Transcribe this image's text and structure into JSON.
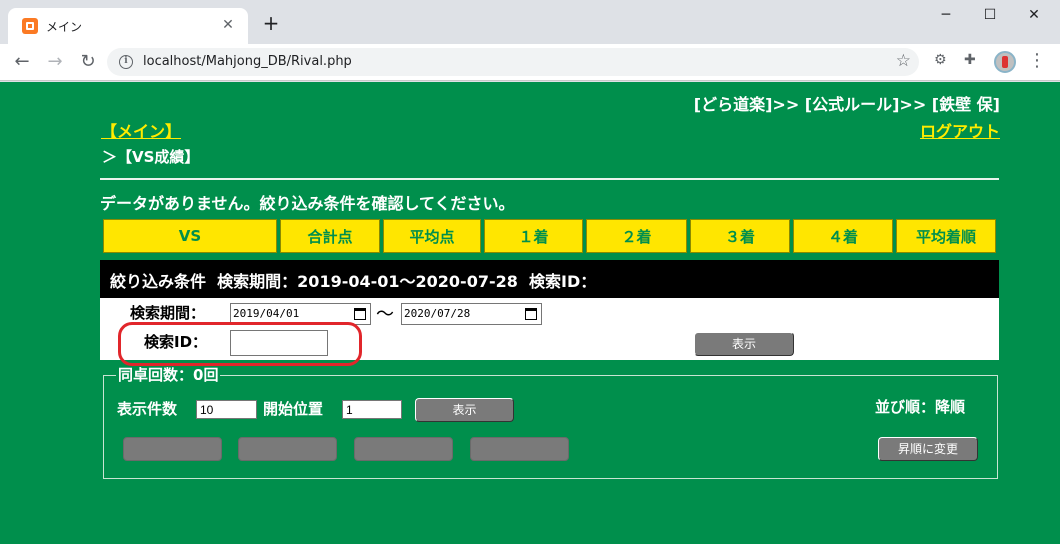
{
  "browser": {
    "tab_title": "メイン",
    "tab_close": "✕",
    "new_tab": "+",
    "url": "localhost/Mahjong_DB/Rival.php",
    "window": {
      "minimize": "─",
      "maximize": "☐",
      "close": "✕"
    }
  },
  "header": {
    "breadcrumb": "[どら道楽]>> [公式ルール]>> [鉄壁 保]",
    "main_link": "【メイン】",
    "logout_link": "ログアウト",
    "current_page": "＞【VS成績】"
  },
  "message": "データがありません。絞り込み条件を確認してください。",
  "table": {
    "columns": [
      "VS",
      "合計点",
      "平均点",
      "１着",
      "２着",
      "３着",
      "４着",
      "平均着順"
    ]
  },
  "filter": {
    "summary_title": "絞り込み条件",
    "summary_period_label": "検索期間：",
    "summary_period_value": "2019-04-01～2020-07-28",
    "summary_id_label": "検索ID：",
    "period_label": "検索期間：",
    "date_from": "2019/04/01",
    "date_to": "2020/07/28",
    "tilde": "〜",
    "id_label": "検索ID：",
    "id_value": "",
    "show_button": "表示"
  },
  "paging": {
    "legend": "同卓回数：0回",
    "count_label": "表示件数",
    "count_value": "10",
    "start_label": "開始位置",
    "start_value": "1",
    "show_button": "表示",
    "sort_label": "並び順：降順",
    "sort_button": "昇順に変更"
  },
  "colors": {
    "page_bg": "#008f4c",
    "header_cell_bg": "#ffe600",
    "link": "#ffec00",
    "highlight": "#e1262b"
  }
}
